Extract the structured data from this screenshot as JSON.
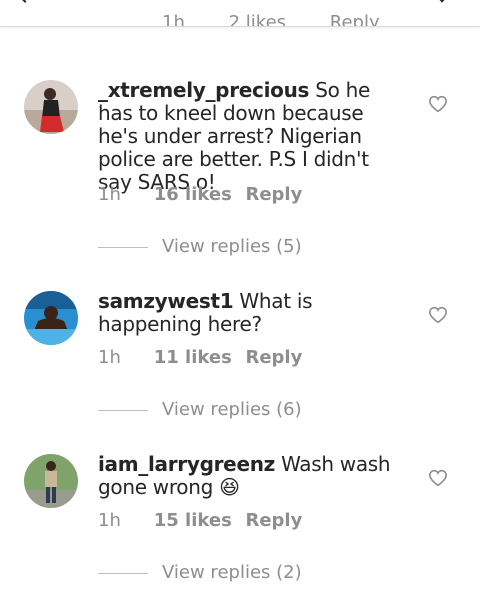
{
  "header": {
    "time": "1h",
    "likes": "2 likes",
    "reply": "Reply"
  },
  "comments": [
    {
      "username": "_xtremely_precious",
      "text": "So he has to kneel down because he's under arrest? Nigerian police are better. P.S I didn't say SARS o!",
      "time": "1h",
      "likes": "16 likes",
      "reply": "Reply",
      "view_replies": "View replies (5)"
    },
    {
      "username": "samzywest1",
      "text": "What is happening here?",
      "time": "1h",
      "likes": "11 likes",
      "reply": "Reply",
      "view_replies": "View replies (6)"
    },
    {
      "username": "iam_larrygreenz",
      "text": "Wash wash gone wrong 😆",
      "time": "1h",
      "likes": "15 likes",
      "reply": "Reply",
      "view_replies": "View replies (2)"
    }
  ],
  "colors": {
    "text": "#262626",
    "muted": "#8e8e8e"
  }
}
